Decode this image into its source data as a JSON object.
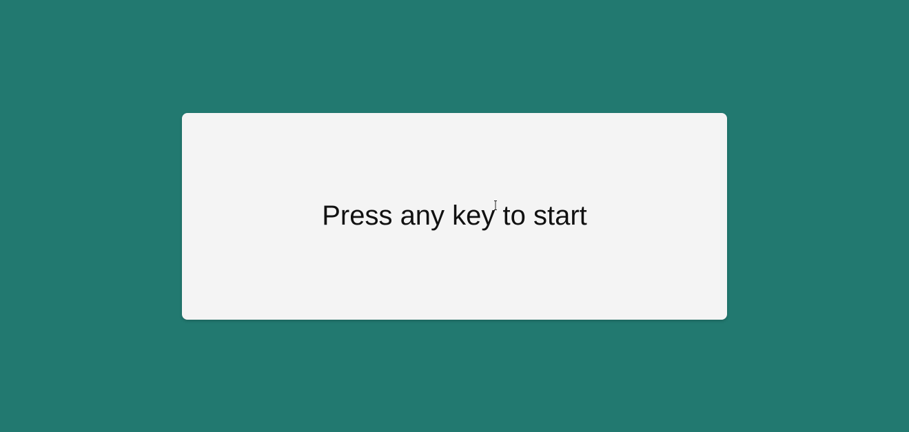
{
  "app": {
    "background_color": "#227970",
    "card_color": "#f4f4f4"
  },
  "start_screen": {
    "prompt": "Press any key to start"
  },
  "cursor": {
    "icon": "i-beam-cursor-icon"
  }
}
